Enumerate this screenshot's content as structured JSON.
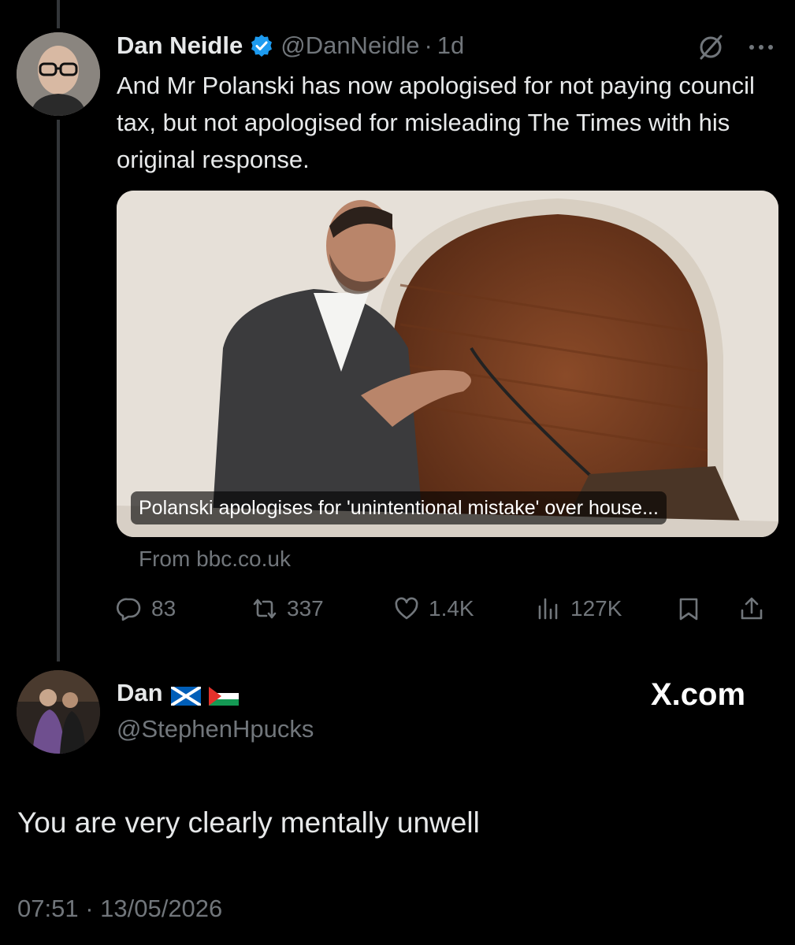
{
  "original_tweet": {
    "display_name": "Dan Neidle",
    "handle": "@DanNeidle",
    "dot": "·",
    "time": "1d",
    "text": "And Mr Polanski has now apologised for not paying council tax, but not apologised for misleading The Times with his original response.",
    "card": {
      "caption": "Polanski apologises for 'unintentional mistake' over house...",
      "source": "From bbc.co.uk"
    },
    "stats": {
      "replies": "83",
      "reposts": "337",
      "likes": "1.4K",
      "views": "127K"
    }
  },
  "reply_tweet": {
    "display_name": "Dan",
    "handle": "@StephenHpucks",
    "text": "You are very clearly mentally unwell",
    "timestamp": "07:51 · 13/05/2026"
  },
  "watermark": "X.com",
  "colors": {
    "background": "#000000",
    "text_primary": "#e7e9ea",
    "text_secondary": "#71767b",
    "verified_blue": "#1d9bf0"
  },
  "icons": {
    "verified": "verified-badge-icon",
    "grok": "grok-icon",
    "more": "more-icon",
    "reply": "reply-icon",
    "repost": "repost-icon",
    "like": "heart-icon",
    "views": "views-icon",
    "bookmark": "bookmark-icon",
    "share": "share-icon",
    "flag_scotland": "scotland-flag-icon",
    "flag_palestine": "palestine-flag-icon"
  }
}
